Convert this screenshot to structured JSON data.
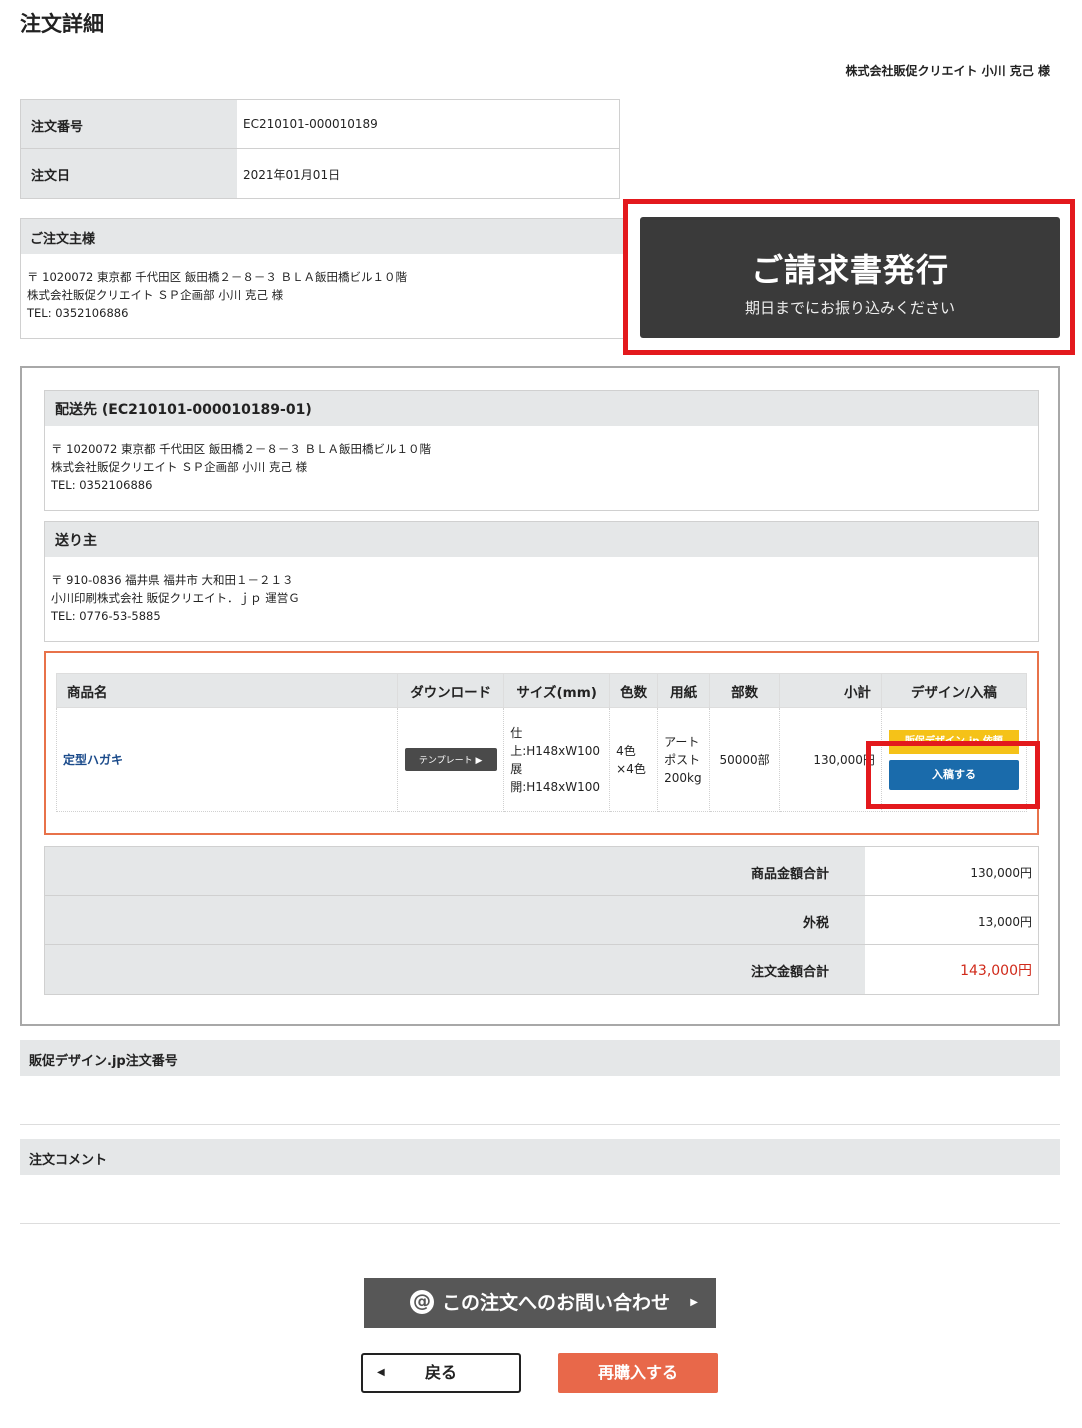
{
  "page": {
    "title": "注文詳細",
    "customer": "株式会社販促クリエイト 小川 克己 様"
  },
  "order_info": [
    {
      "label": "注文番号",
      "value": "EC210101-000010189"
    },
    {
      "label": "注文日",
      "value": "2021年01月01日"
    }
  ],
  "orderer": {
    "heading": "ご注文主様",
    "lines": [
      "〒 1020072 東京都 千代田区 飯田橋２－８－３ ＢＬＡ飯田橋ビル１０階",
      "株式会社販促クリエイト ＳＰ企画部 小川 克己 様",
      "TEL: 0352106886"
    ]
  },
  "invoice": {
    "title": "ご請求書発行",
    "subtitle": "期日までにお振り込みください"
  },
  "shipping": {
    "heading": "配送先 (EC210101-000010189-01)",
    "lines": [
      "〒 1020072 東京都 千代田区 飯田橋２－８－３ ＢＬＡ飯田橋ビル１０階",
      "株式会社販促クリエイト ＳＰ企画部 小川 克己 様",
      "TEL: 0352106886"
    ]
  },
  "sender": {
    "heading": "送り主",
    "lines": [
      "〒 910-0836 福井県 福井市 大和田１－２１３",
      "小川印刷株式会社 販促クリエイト．ｊｐ 運営Ｇ",
      "TEL: 0776-53-5885"
    ]
  },
  "products": {
    "headers": [
      "商品名",
      "ダウンロード",
      "サイズ(mm)",
      "色数",
      "用紙",
      "部数",
      "小計",
      "デザイン/入稿"
    ],
    "rows": [
      {
        "name": "定型ハガキ",
        "download": "テンプレート",
        "size_lines": [
          "仕",
          "上:H148xW100",
          "展",
          "開:H148xW100"
        ],
        "colors_lines": [
          "4色",
          "×4色"
        ],
        "paper_lines": [
          "アート",
          "ポスト",
          "200kg"
        ],
        "qty": "50000部",
        "subtotal": "130,000円",
        "design_btn": "販促デザイン.jp 依頼",
        "upload_btn": "入稿する"
      }
    ]
  },
  "totals": [
    {
      "label": "商品金額合計",
      "value": "130,000円"
    },
    {
      "label": "外税",
      "value": "13,000円"
    },
    {
      "label": "注文金額合計",
      "value": "143,000円"
    }
  ],
  "design_order": {
    "heading": "販促デザイン.jp注文番号"
  },
  "comment": {
    "heading": "注文コメント"
  },
  "buttons": {
    "contact": "この注文へのお問い合わせ",
    "back": "戻る",
    "rebuy": "再購入する"
  },
  "colors": {
    "accent_red": "#e3191d",
    "upload_blue": "#1a6bab",
    "rebuy_orange": "#e8684a",
    "design_yellow": "#f5c218"
  }
}
